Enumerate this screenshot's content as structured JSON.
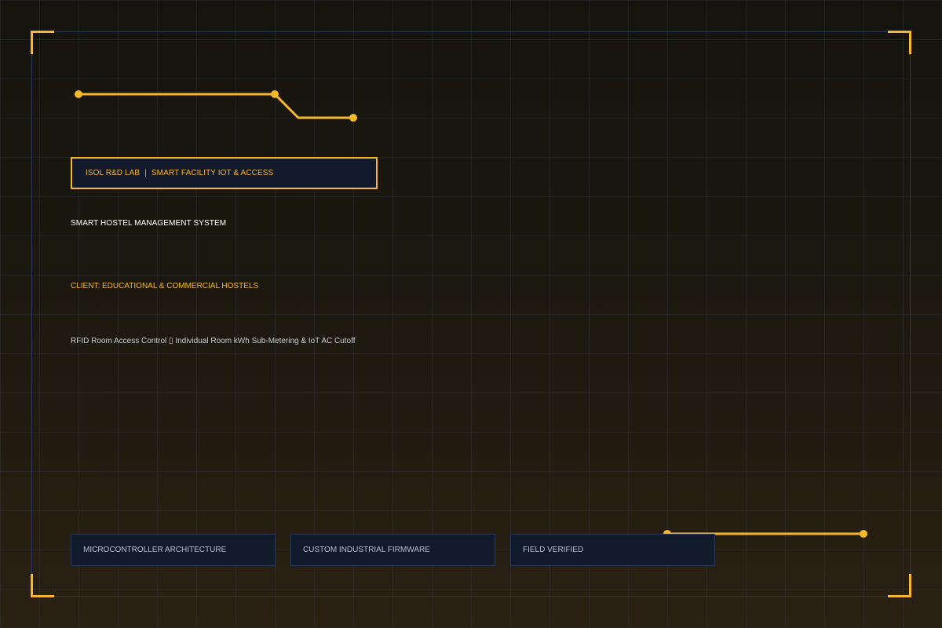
{
  "header": {
    "lab_name": "ISOL R&D LAB",
    "separator": "|",
    "division": "SMART FACILITY IOT & ACCESS"
  },
  "project": {
    "title": "SMART HOSTEL MANAGEMENT SYSTEM",
    "client": "CLIENT: EDUCATIONAL & COMMERCIAL HOSTELS",
    "features": "RFID Room Access Control ▯ Individual Room kWh Sub-Metering & IoT AC Cutoff"
  },
  "tags": [
    {
      "label": "MICROCONTROLLER ARCHITECTURE"
    },
    {
      "label": "CUSTOM INDUSTRIAL FIRMWARE"
    },
    {
      "label": "FIELD VERIFIED"
    }
  ],
  "colors": {
    "accent": "#f6b82a",
    "panel": "#121a2c",
    "frame_border": "#2b3956",
    "background_top": "#16140f",
    "background_bottom": "#2a2112"
  }
}
